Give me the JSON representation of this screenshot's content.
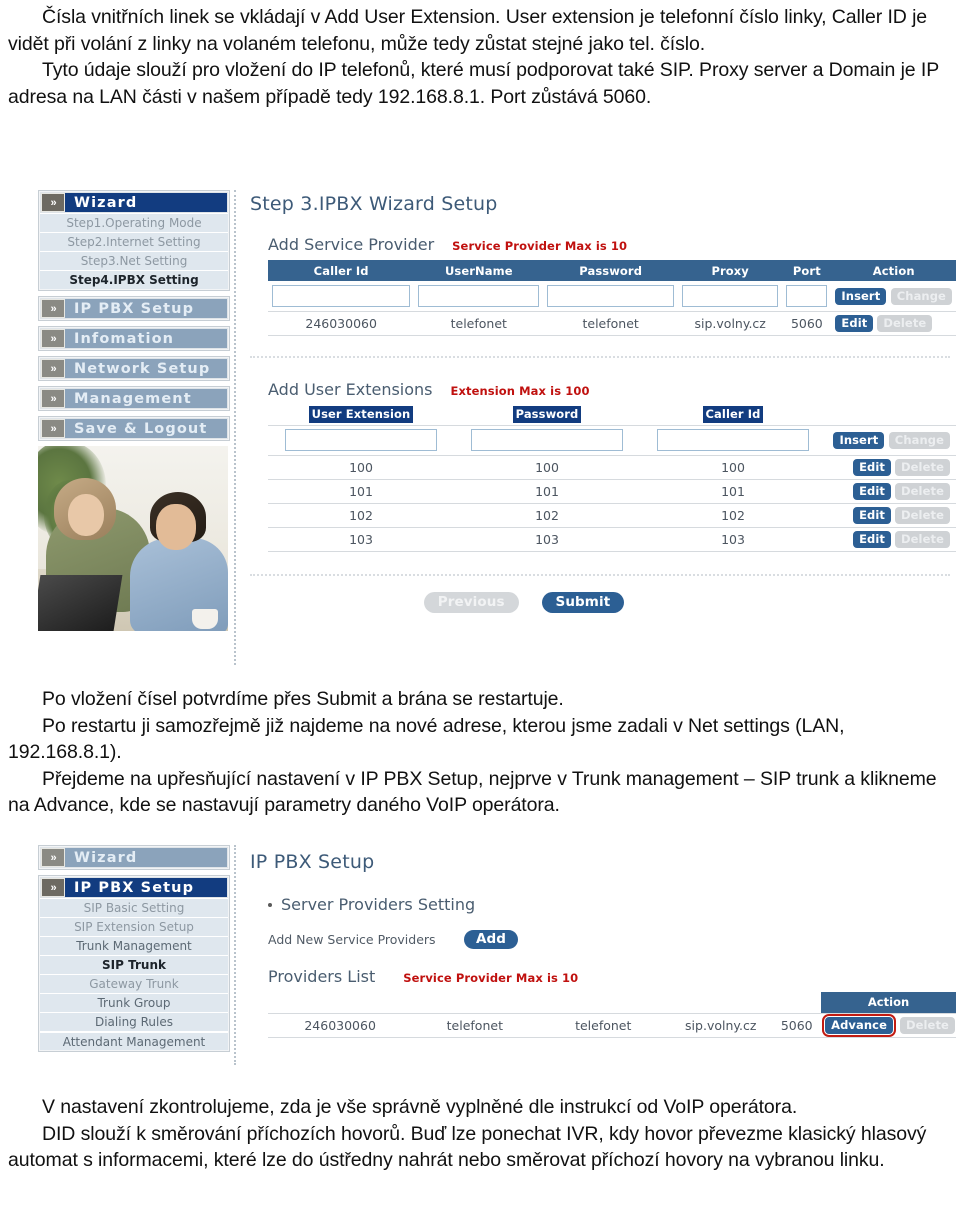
{
  "document": {
    "paragraphs_top": [
      "Čísla vnitřních linek se vkládají v Add User Extension. User extension je telefonní číslo linky, Caller ID je vidět při volání z linky na volaném telefonu, může tedy zůstat stejné jako tel. číslo.",
      "Tyto údaje slouží pro vložení do IP telefonů, které musí podporovat také SIP. Proxy server a Domain je IP adresa na LAN části v našem případě tedy 192.168.8.1. Port zůstává 5060."
    ],
    "paragraphs_mid": [
      "Po vložení čísel potvrdíme přes Submit a brána se restartuje.",
      "Po restartu ji samozřejmě již najdeme na nové adrese, kterou jsme zadali v Net settings (LAN, 192.168.8.1).",
      "Přejdeme na upřesňující nastavení v IP PBX Setup, nejprve v Trunk management – SIP trunk a klikneme na Advance, kde se nastavují parametry daného VoIP operátora."
    ],
    "paragraphs_bottom": [
      "V nastavení zkontrolujeme, zda je vše správně vyplněné dle instrukcí od VoIP operátora.",
      "DID slouží k směrování příchozích hovorů. Buď lze ponechat IVR, kdy hovor převezme klasický hlasový automat s informacemi, které lze do ústředny nahrát nebo směrovat příchozí hovory na vybranou linku."
    ]
  },
  "colors": {
    "table_header_blue": "#36638f",
    "active_nav_blue": "#123c80",
    "inactive_nav_blue": "#8ba3bb",
    "button_blue": "#2c5f94",
    "warning_red": "#c0110f",
    "highlight_red": "#c11b12",
    "title_blue": "#3d5a78"
  },
  "screenshot1": {
    "nav": {
      "chevron_glyph": "»",
      "groups": [
        {
          "label": "Wizard",
          "state": "active",
          "items": [
            {
              "label": "Step1.Operating Mode",
              "state": "dim"
            },
            {
              "label": "Step2.Internet Setting",
              "state": "dim"
            },
            {
              "label": "Step3.Net Setting",
              "state": "dim"
            },
            {
              "label": "Step4.IPBX Setting",
              "state": "selected"
            }
          ]
        },
        {
          "label": "IP PBX Setup",
          "state": "normal",
          "items": []
        },
        {
          "label": "Infomation",
          "state": "normal",
          "items": []
        },
        {
          "label": "Network Setup",
          "state": "normal",
          "items": []
        },
        {
          "label": "Management",
          "state": "normal",
          "items": []
        },
        {
          "label": "Save & Logout",
          "state": "normal",
          "items": []
        }
      ],
      "photo_alt": "stock-photo-couple-with-laptop"
    },
    "page_title": "Step 3.IPBX Wizard Setup",
    "service_provider": {
      "heading": "Add Service Provider",
      "note": "Service Provider Max is 10",
      "columns": [
        "Caller Id",
        "UserName",
        "Password",
        "Proxy",
        "Port",
        "Action"
      ],
      "input_row": {
        "caller_id": "",
        "username": "",
        "password": "",
        "proxy": "",
        "port": "",
        "insert_label": "Insert",
        "change_label": "Change"
      },
      "rows": [
        {
          "caller_id": "246030060",
          "username": "telefonet",
          "password": "telefonet",
          "proxy": "sip.volny.cz",
          "port": "5060",
          "edit_label": "Edit",
          "delete_label": "Delete"
        }
      ]
    },
    "user_extensions": {
      "heading": "Add User Extensions",
      "note": "Extension Max is 100",
      "columns": [
        "User Extension",
        "Password",
        "Caller Id"
      ],
      "input_row": {
        "user_extension": "",
        "password": "",
        "caller_id": "",
        "insert_label": "Insert",
        "change_label": "Change"
      },
      "rows": [
        {
          "user_extension": "100",
          "password": "100",
          "caller_id": "100",
          "edit_label": "Edit",
          "delete_label": "Delete"
        },
        {
          "user_extension": "101",
          "password": "101",
          "caller_id": "101",
          "edit_label": "Edit",
          "delete_label": "Delete"
        },
        {
          "user_extension": "102",
          "password": "102",
          "caller_id": "102",
          "edit_label": "Edit",
          "delete_label": "Delete"
        },
        {
          "user_extension": "103",
          "password": "103",
          "caller_id": "103",
          "edit_label": "Edit",
          "delete_label": "Delete"
        }
      ]
    },
    "footer_buttons": {
      "previous_label": "Previous",
      "submit_label": "Submit"
    }
  },
  "screenshot2": {
    "nav": {
      "chevron_glyph": "»",
      "groups": [
        {
          "label": "Wizard",
          "state": "normal",
          "items": []
        },
        {
          "label": "IP PBX Setup",
          "state": "active",
          "items": [
            {
              "label": "SIP Basic Setting",
              "state": "dim"
            },
            {
              "label": "SIP Extension Setup",
              "state": "dim"
            },
            {
              "label": "Trunk Management",
              "state": "normal"
            },
            {
              "label": "SIP Trunk",
              "state": "selected"
            },
            {
              "label": "Gateway Trunk",
              "state": "dim"
            },
            {
              "label": "Trunk Group",
              "state": "normal"
            },
            {
              "label": "Dialing Rules",
              "state": "normal"
            },
            {
              "label": "Attendant Management",
              "state": "normal"
            }
          ]
        }
      ]
    },
    "page_title": "IP PBX Setup",
    "section_heading": "Server Providers Setting",
    "add_new_label": "Add New Service Providers",
    "add_button_label": "Add",
    "providers_list_heading": "Providers List",
    "providers_note": "Service Provider Max is 10",
    "action_column_label": "Action",
    "rows": [
      {
        "caller_id": "246030060",
        "username": "telefonet",
        "password": "telefonet",
        "proxy": "sip.volny.cz",
        "port": "5060",
        "advance_label": "Advance",
        "delete_label": "Delete"
      }
    ]
  }
}
